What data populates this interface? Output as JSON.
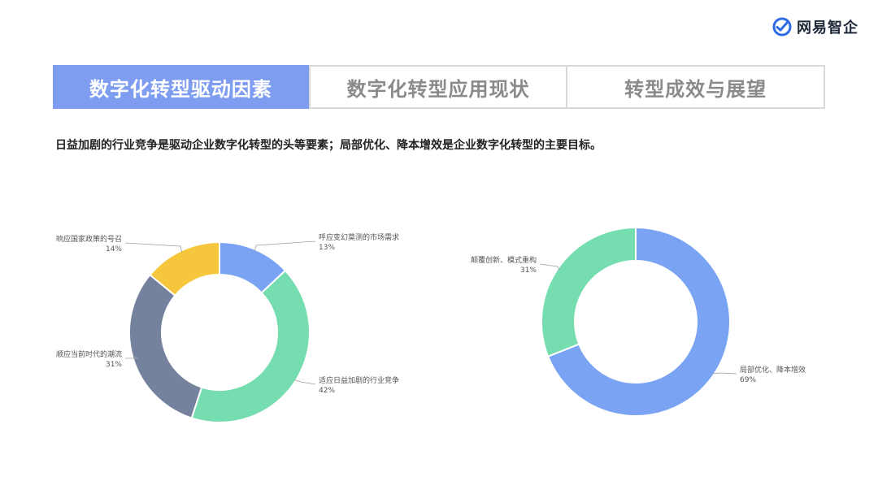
{
  "brand": {
    "name": "网易智企",
    "logo_icon": "netease-check-logo-icon",
    "logo_color": "#2f6be6"
  },
  "tabs": [
    {
      "label": "数字化转型驱动因素",
      "active": true
    },
    {
      "label": "数字化转型应用现状",
      "active": false
    },
    {
      "label": "转型成效与展望",
      "active": false
    }
  ],
  "headline": "日益加剧的行业竞争是驱动企业数字化转型的头等要素；局部优化、降本增效是企业数字化转型的主要目标。",
  "colors": {
    "active_tab": "#7e9df0",
    "blue": "#7aa3f4",
    "green": "#76ddb0",
    "slate": "#74829e",
    "yellow": "#f6c73c"
  },
  "chart_data": [
    {
      "type": "pie",
      "donut": true,
      "slices": [
        {
          "label": "呼应变幻莫测的市场需求",
          "value": 13,
          "value_label": "13%",
          "color": "#7aa3f4"
        },
        {
          "label": "适应日益加剧的行业竞争",
          "value": 42,
          "value_label": "42%",
          "color": "#76ddb0"
        },
        {
          "label": "顺应当前时代的潮流",
          "value": 31,
          "value_label": "31%",
          "color": "#74829e"
        },
        {
          "label": "响应国家政策的号召",
          "value": 14,
          "value_label": "14%",
          "color": "#f6c73c"
        }
      ]
    },
    {
      "type": "pie",
      "donut": true,
      "slices": [
        {
          "label": "局部优化、降本增效",
          "value": 69,
          "value_label": "69%",
          "color": "#7aa3f4"
        },
        {
          "label": "颠覆创新、模式重构",
          "value": 31,
          "value_label": "31%",
          "color": "#76ddb0"
        }
      ]
    }
  ]
}
